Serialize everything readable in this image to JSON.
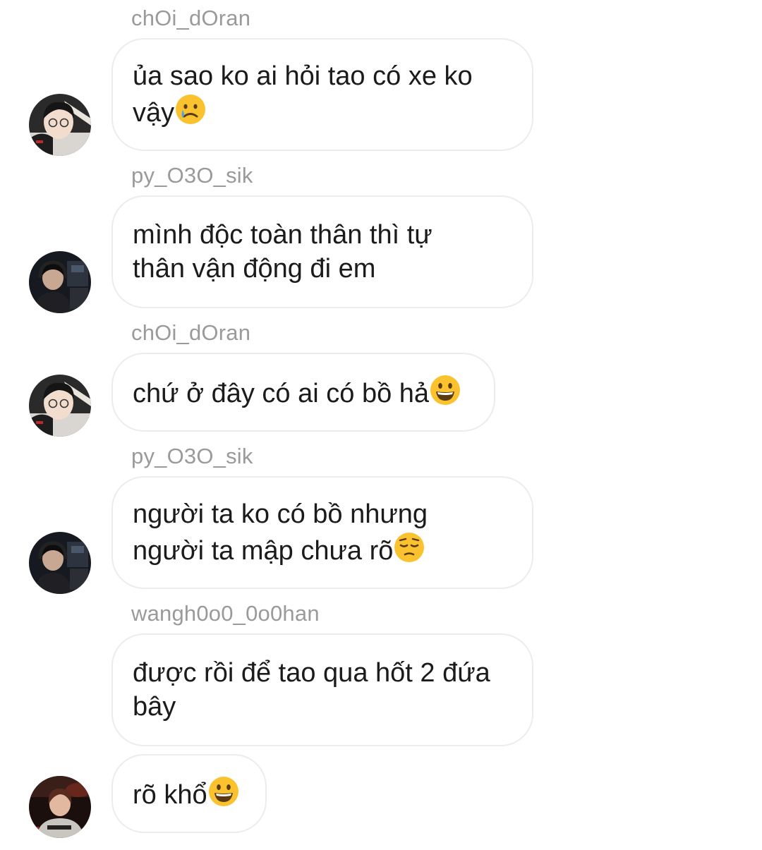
{
  "messages": [
    {
      "sender": "chOi_dOran",
      "text": "ủa sao ko ai hỏi tao có xe ko\nvậy",
      "emoji": "crying-face",
      "avatar": "avatar-choi"
    },
    {
      "sender": "py_O3O_sik",
      "text": "mình độc toàn thân thì tự\nthân vận động đi em",
      "emoji": "",
      "avatar": "avatar-py"
    },
    {
      "sender": "chOi_dOran",
      "text": "chứ ở đây có ai có bồ hả",
      "emoji": "grinning-face",
      "avatar": "avatar-choi"
    },
    {
      "sender": "py_O3O_sik",
      "text": "người ta ko có bồ nhưng\nngười ta mập chưa rõ",
      "emoji": "pensive-face",
      "avatar": "avatar-py"
    },
    {
      "sender": "wangh0o0_0o0han",
      "text": "được rồi để tao qua hốt 2 đứa\nbây",
      "emoji": "",
      "avatar": ""
    },
    {
      "sender": "",
      "text": "rõ khổ",
      "emoji": "grinning-face",
      "avatar": "avatar-wang"
    }
  ],
  "colors": {
    "sender": "#9a9a9a",
    "text": "#1b1b1b",
    "bubble_border": "#ececec",
    "emoji_yellow": "#f9c22e"
  }
}
